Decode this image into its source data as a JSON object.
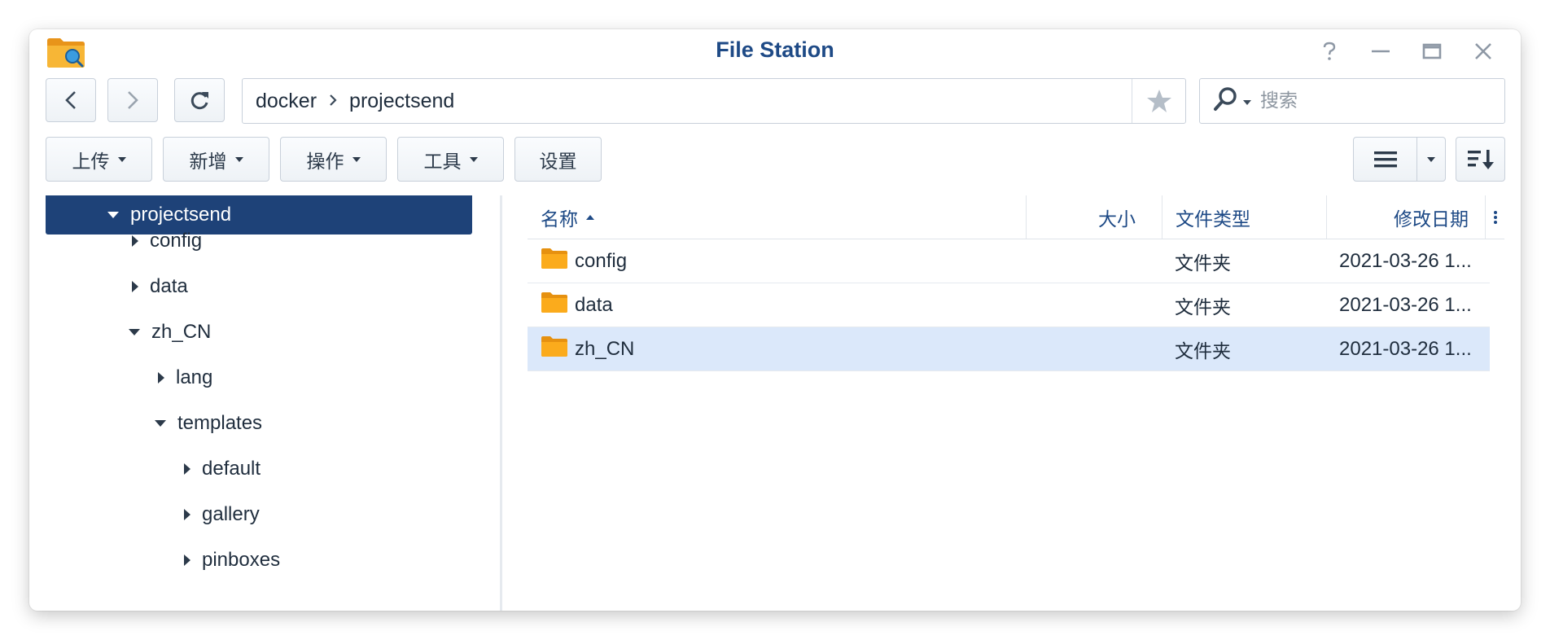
{
  "window": {
    "title": "File Station"
  },
  "navigation": {
    "breadcrumb": [
      "docker",
      "projectsend"
    ],
    "search_placeholder": "搜索"
  },
  "toolbar": {
    "upload": "上传",
    "create": "新增",
    "action": "操作",
    "tools": "工具",
    "settings": "设置"
  },
  "tree": {
    "items": [
      {
        "label": "projectsend",
        "expanded": true,
        "selected": true
      },
      {
        "label": "config",
        "expanded": false
      },
      {
        "label": "data",
        "expanded": false
      },
      {
        "label": "zh_CN",
        "expanded": true
      },
      {
        "label": "lang",
        "expanded": false
      },
      {
        "label": "templates",
        "expanded": true
      },
      {
        "label": "default",
        "expanded": false
      },
      {
        "label": "gallery",
        "expanded": false
      },
      {
        "label": "pinboxes",
        "expanded": false
      }
    ]
  },
  "file_list": {
    "columns": {
      "name": "名称",
      "size": "大小",
      "type": "文件类型",
      "modified": "修改日期"
    },
    "rows": [
      {
        "name": "config",
        "size": "",
        "type": "文件夹",
        "modified": "2021-03-26 1...",
        "selected": false
      },
      {
        "name": "data",
        "size": "",
        "type": "文件夹",
        "modified": "2021-03-26 1...",
        "selected": false
      },
      {
        "name": "zh_CN",
        "size": "",
        "type": "文件夹",
        "modified": "2021-03-26 1...",
        "selected": true
      }
    ]
  },
  "colors": {
    "title": "#1e4a86",
    "tree_selected_bg": "#1e4278",
    "row_selected_bg": "#dbe8fa",
    "folder": "#f7a81b"
  },
  "icons": [
    "file-station-app-icon",
    "help-icon",
    "minimize-icon",
    "maximize-icon",
    "close-icon",
    "back-icon",
    "forward-icon",
    "refresh-icon",
    "breadcrumb-chevron-icon",
    "favorite-star-icon",
    "search-icon",
    "list-view-icon",
    "sort-icon",
    "folder-icon",
    "more-columns-icon"
  ]
}
